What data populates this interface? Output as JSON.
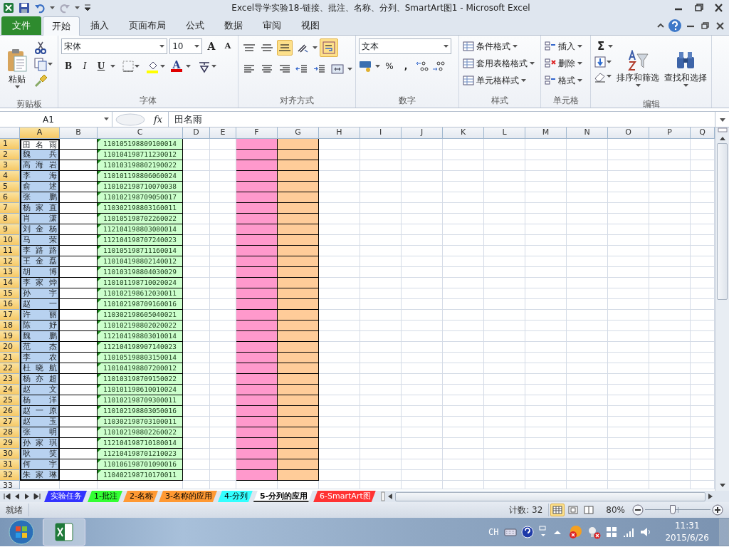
{
  "window": {
    "title": "Excel导学实验18-链接、批注、名称、分列、SmartArt图1  -  Microsoft Excel"
  },
  "ribbon_tabs": [
    {
      "label": "文件",
      "kind": "file",
      "selected": false
    },
    {
      "label": "开始",
      "kind": "tab",
      "selected": true
    },
    {
      "label": "插入",
      "kind": "tab",
      "selected": false
    },
    {
      "label": "页面布局",
      "kind": "tab",
      "selected": false
    },
    {
      "label": "公式",
      "kind": "tab",
      "selected": false
    },
    {
      "label": "数据",
      "kind": "tab",
      "selected": false
    },
    {
      "label": "审阅",
      "kind": "tab",
      "selected": false
    },
    {
      "label": "视图",
      "kind": "tab",
      "selected": false
    }
  ],
  "ribbon": {
    "clipboard": {
      "paste": "粘贴",
      "label": "剪贴板"
    },
    "font": {
      "font_name": "宋体",
      "font_size": "10",
      "grow": "A",
      "shrink": "A",
      "bold": "B",
      "italic": "I",
      "underline": "U",
      "font_color": "A",
      "label": "字体"
    },
    "alignment": {
      "buttons": [
        {
          "kind": "top",
          "selected": false
        },
        {
          "kind": "middle",
          "selected": false
        },
        {
          "kind": "bottom",
          "selected": true
        },
        {
          "kind": "orient",
          "selected": false
        },
        {
          "kind": "wrap",
          "selected": true
        },
        {
          "kind": "left",
          "selected": false
        },
        {
          "kind": "center",
          "selected": false
        },
        {
          "kind": "right",
          "selected": false
        },
        {
          "kind": "outdent",
          "selected": false
        },
        {
          "kind": "indent",
          "selected": false
        },
        {
          "kind": "merge",
          "selected": false
        }
      ],
      "label": "对齐方式"
    },
    "number": {
      "format": "文本",
      "percent": "%",
      "comma": ",",
      "label": "数字"
    },
    "styles": {
      "items": [
        "条件格式",
        "套用表格格式",
        "单元格样式"
      ],
      "label": "样式"
    },
    "cells": {
      "items": [
        "插入",
        "删除",
        "格式"
      ],
      "label": "单元格"
    },
    "editing": {
      "sum": "Σ",
      "sort": "排序和筛选",
      "find": "查找和选择",
      "label": "编辑"
    }
  },
  "formula_bar": {
    "name_box": "A1",
    "fx": "fx",
    "value": "田名雨"
  },
  "columns": [
    {
      "label": "A",
      "selected": true
    },
    {
      "label": "B",
      "selected": false
    },
    {
      "label": "C",
      "selected": false
    },
    {
      "label": "D",
      "selected": false
    },
    {
      "label": "E",
      "selected": false
    },
    {
      "label": "F",
      "selected": false
    },
    {
      "label": "G",
      "selected": false
    },
    {
      "label": "H",
      "selected": false
    },
    {
      "label": "I",
      "selected": false
    },
    {
      "label": "J",
      "selected": false
    },
    {
      "label": "K",
      "selected": false
    },
    {
      "label": "L",
      "selected": false
    },
    {
      "label": "M",
      "selected": false
    },
    {
      "label": "N",
      "selected": false
    },
    {
      "label": "O",
      "selected": false
    },
    {
      "label": "P",
      "selected": false
    },
    {
      "label": "Q",
      "selected": false
    }
  ],
  "rows": [
    {
      "number": "1",
      "name": "田 名 雨",
      "id": "110105198809100014",
      "selected": true,
      "active": true
    },
    {
      "number": "2",
      "name": "魏 兵",
      "id": "110104198711230012",
      "selected": true,
      "active": false
    },
    {
      "number": "3",
      "name": "高 海 岩",
      "id": "110103198802190022",
      "selected": true,
      "active": false
    },
    {
      "number": "4",
      "name": "李 海",
      "id": "110101198806060024",
      "selected": true,
      "active": false
    },
    {
      "number": "5",
      "name": "俞 述",
      "id": "110102198710070038",
      "selected": true,
      "active": false
    },
    {
      "number": "6",
      "name": "张 鹏",
      "id": "110102198709050017",
      "selected": true,
      "active": false
    },
    {
      "number": "7",
      "name": "杨 家 直",
      "id": "110302198803160011",
      "selected": true,
      "active": false
    },
    {
      "number": "8",
      "name": "肖 潇",
      "id": "110105198702260022",
      "selected": true,
      "active": false
    },
    {
      "number": "9",
      "name": "刘 金 杨",
      "id": "112104198803080014",
      "selected": true,
      "active": false
    },
    {
      "number": "10",
      "name": "马 荣",
      "id": "112104198707240023",
      "selected": true,
      "active": false
    },
    {
      "number": "11",
      "name": "李 路 路",
      "id": "110105198711160014",
      "selected": true,
      "active": false
    },
    {
      "number": "12",
      "name": "王 金 磊",
      "id": "110104198802140012",
      "selected": true,
      "active": false
    },
    {
      "number": "13",
      "name": "胡 博",
      "id": "110103198804030029",
      "selected": true,
      "active": false
    },
    {
      "number": "14",
      "name": "李 家 烨",
      "id": "110101198710020024",
      "selected": true,
      "active": false
    },
    {
      "number": "15",
      "name": "孙 宇",
      "id": "110102198612030011",
      "selected": true,
      "active": false
    },
    {
      "number": "16",
      "name": "赵 一",
      "id": "110102198709160016",
      "selected": true,
      "active": false
    },
    {
      "number": "17",
      "name": "许 丽",
      "id": "110302198605040021",
      "selected": true,
      "active": false
    },
    {
      "number": "18",
      "name": "陈 妤",
      "id": "110102198802020022",
      "selected": true,
      "active": false
    },
    {
      "number": "19",
      "name": "魏 鹏",
      "id": "112104198803010014",
      "selected": true,
      "active": false
    },
    {
      "number": "20",
      "name": "范 杰",
      "id": "112104198907140023",
      "selected": true,
      "active": false
    },
    {
      "number": "21",
      "name": "李 农",
      "id": "110105198803150014",
      "selected": true,
      "active": false
    },
    {
      "number": "22",
      "name": "杜 晓 航",
      "id": "110104198807200012",
      "selected": true,
      "active": false
    },
    {
      "number": "23",
      "name": "杨 亦 超",
      "id": "110103198709150022",
      "selected": true,
      "active": false
    },
    {
      "number": "24",
      "name": "赵 文",
      "id": "110101198610010024",
      "selected": true,
      "active": false
    },
    {
      "number": "25",
      "name": "杨 洋",
      "id": "110102198709300011",
      "selected": true,
      "active": false
    },
    {
      "number": "26",
      "name": "赵 一 原",
      "id": "110102198803050016",
      "selected": true,
      "active": false
    },
    {
      "number": "27",
      "name": "赵 玉",
      "id": "110302198703100011",
      "selected": true,
      "active": false
    },
    {
      "number": "28",
      "name": "张 明",
      "id": "110102198802260022",
      "selected": true,
      "active": false
    },
    {
      "number": "29",
      "name": "孙 家 琪",
      "id": "112104198710180014",
      "selected": true,
      "active": false
    },
    {
      "number": "30",
      "name": "耿 笑",
      "id": "112104198701210023",
      "selected": true,
      "active": false
    },
    {
      "number": "31",
      "name": "何 宇",
      "id": "110106198701090016",
      "selected": true,
      "active": false
    },
    {
      "number": "32",
      "name": "朱 家 琳",
      "id": "110402198710170011",
      "selected": true,
      "active": false
    },
    {
      "number": "33",
      "selected": false
    }
  ],
  "sheet_tabs": [
    {
      "label": "实验任务",
      "color": "#3333ff",
      "selected": false
    },
    {
      "label": "1-批注",
      "color": "#33ff33",
      "selected": false
    },
    {
      "label": "2-名称",
      "color": "#ff9933",
      "selected": false
    },
    {
      "label": "3-名称的应用",
      "color": "#ff9933",
      "selected": false
    },
    {
      "label": "4-分列",
      "color": "#33ffff",
      "selected": false
    },
    {
      "label": "5-分列的应用",
      "color": "#ffffff",
      "selected": true
    },
    {
      "label": "6-SmartArt图",
      "color": "#ff3333",
      "selected": false
    }
  ],
  "status_bar": {
    "ready": "就绪",
    "count": "计数: 32",
    "views": [
      {
        "kind": "normal",
        "selected": true
      },
      {
        "kind": "layout",
        "selected": false
      },
      {
        "kind": "pagebreak",
        "selected": false
      }
    ],
    "zoom": "80%",
    "zoom_level": {
      "level": 0.42
    }
  },
  "taskbar": {
    "language": "CH",
    "time": "11:31",
    "date": "2015/6/26"
  }
}
